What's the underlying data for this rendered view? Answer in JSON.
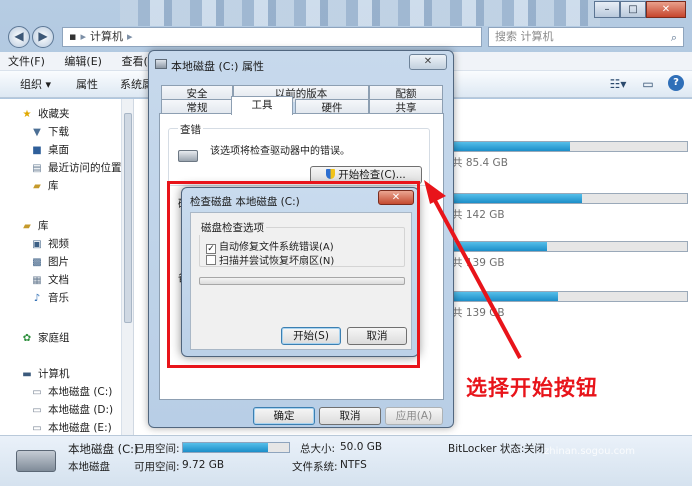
{
  "window": {
    "controls": [
      "–",
      "□",
      "✕"
    ]
  },
  "address": {
    "path": "计算机",
    "search_placeholder": "搜索 计算机"
  },
  "menu": [
    "文件(F)",
    "编辑(E)",
    "查看(V)"
  ],
  "toolbar": {
    "organize": "组织 ▾",
    "properties": "属性",
    "system": "系统属"
  },
  "sidebar": {
    "favorites": "收藏夹",
    "items_fav": [
      "下载",
      "桌面",
      "最近访问的位置",
      "库"
    ],
    "libraries": "库",
    "items_lib": [
      "视频",
      "图片",
      "文档",
      "音乐"
    ],
    "homegroup": "家庭组",
    "computer": "计算机",
    "drives": [
      "本地磁盘 (C:)",
      "本地磁盘 (D:)",
      "本地磁盘 (E:)"
    ]
  },
  "content_drives": [
    {
      "free": "共 85.4 GB",
      "used": 0.5
    },
    {
      "free": "共 142 GB",
      "used": 0.55
    },
    {
      "free": "共 139 GB",
      "used": 0.4
    },
    {
      "free": "共 139 GB",
      "used": 0.45
    }
  ],
  "status": {
    "name": "本地磁盘 (C:)",
    "type": "本地磁盘",
    "used_label": "已用空间:",
    "free_label": "可用空间:",
    "free_value": "9.72 GB",
    "used": 0.8,
    "total_label": "总大小:",
    "total_value": "50.0 GB",
    "fs_label": "文件系统:",
    "fs_value": "NTFS",
    "bitlocker_label": "BitLocker 状态:",
    "bitlocker_value": "关闭"
  },
  "props": {
    "title": "本地磁盘 (C:) 属性",
    "close": "✕",
    "tabs_row1": [
      "安全",
      "以前的版本",
      "配额"
    ],
    "tabs_row2": [
      "常规",
      "工具",
      "硬件",
      "共享"
    ],
    "section_check": "查错",
    "check_desc": "该选项将检查驱动器中的错误。",
    "check_button": "开始检查(C)...",
    "section_defrag": "碎",
    "section_backup": "备",
    "ok": "确定",
    "cancel": "取消",
    "apply": "应用(A)"
  },
  "chkdsk": {
    "title": "检查磁盘 本地磁盘 (C:)",
    "close": "✕",
    "group": "磁盘检查选项",
    "opt1": "自动修复文件系统错误(A)",
    "opt1_checked": true,
    "opt2": "扫描并尝试恢复坏扇区(N)",
    "opt2_checked": false,
    "start": "开始(S)",
    "cancel": "取消"
  },
  "annotation": {
    "text": "选择开始按钮",
    "color": "#e8141a"
  },
  "watermark": {
    "brand": "搜狗指南",
    "url": "zhinan.sogou.com"
  }
}
